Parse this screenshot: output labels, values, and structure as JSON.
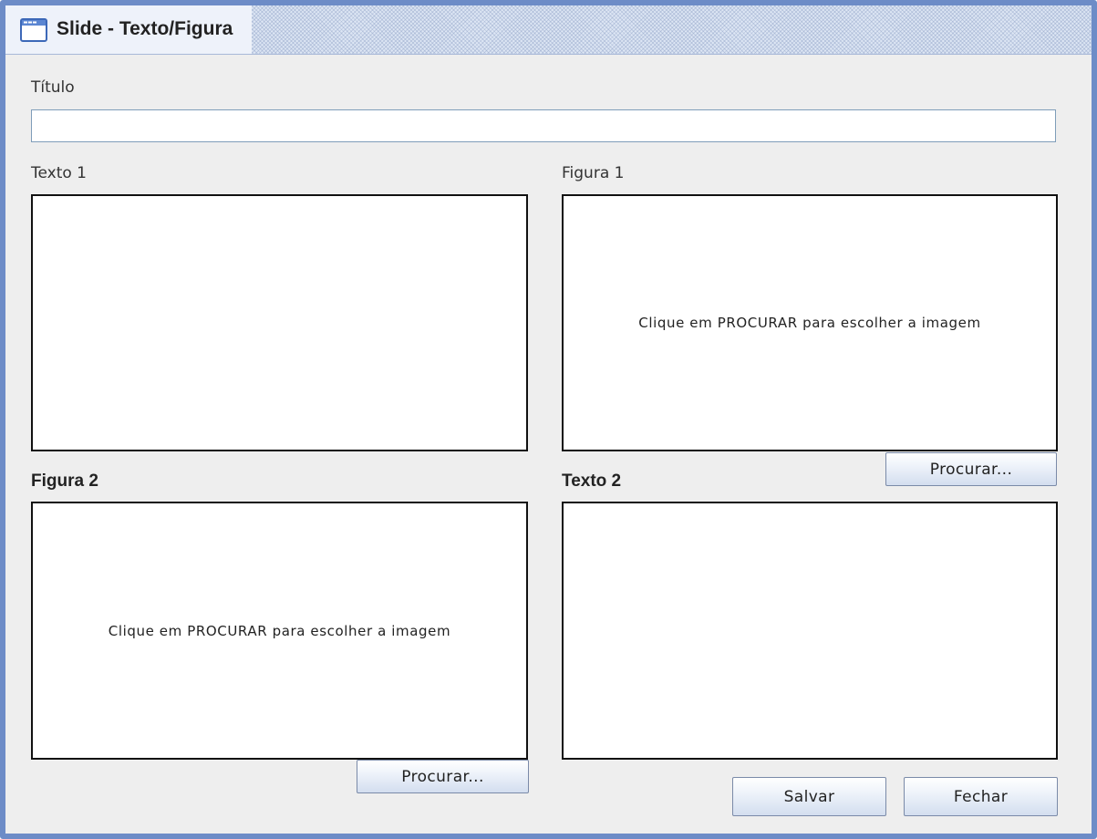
{
  "window": {
    "title": "Slide - Texto/Figura",
    "icon": "window-icon"
  },
  "form": {
    "title_label": "Título",
    "title_value": "",
    "text1": {
      "label": "Texto 1",
      "value": ""
    },
    "figure1": {
      "label": "Figura 1",
      "hint": "Clique em PROCURAR para escolher a imagem",
      "browse_label": "Procurar..."
    },
    "figure2": {
      "label": "Figura 2",
      "hint": "Clique em PROCURAR para escolher a imagem",
      "browse_label": "Procurar..."
    },
    "text2": {
      "label": "Texto 2",
      "value": ""
    }
  },
  "actions": {
    "save_label": "Salvar",
    "close_label": "Fechar"
  },
  "colors": {
    "window_border": "#6d8cc7",
    "panel_bg": "#eeeeee"
  }
}
